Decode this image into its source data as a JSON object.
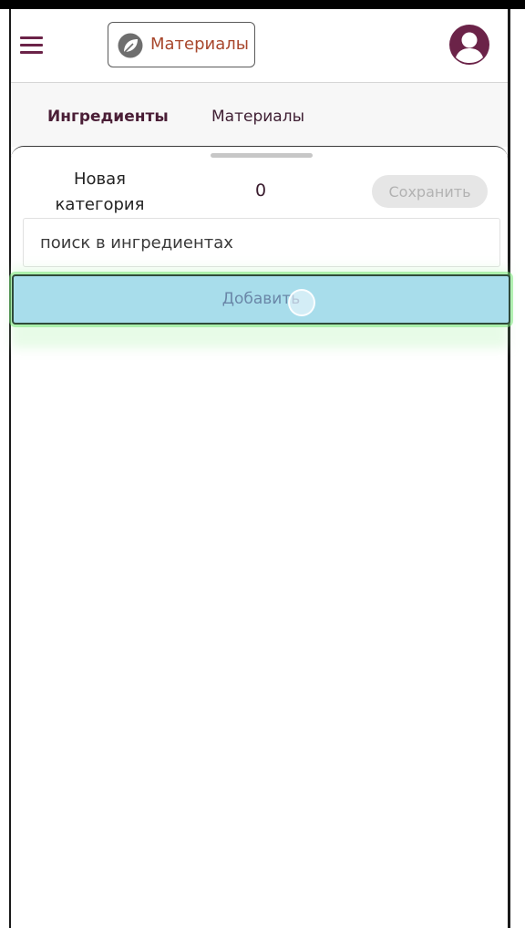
{
  "header": {
    "brand_label": "Материалы",
    "menu_icon": "hamburger-menu-icon",
    "brand_icon": "leaf-icon",
    "avatar_icon": "user-avatar-icon"
  },
  "tabs": [
    {
      "label": "Ингредиенты",
      "active": true
    },
    {
      "label": "Материалы",
      "active": false
    }
  ],
  "sheet": {
    "category_name": "Новая категория",
    "count": "0",
    "save_label": "Сохранить",
    "search_placeholder": "поиск в ингредиентах",
    "add_label": "Добавить"
  },
  "colors": {
    "brand_accent": "#6b2348",
    "brand_text": "#a8472c",
    "add_button_bg": "#a8ddeb",
    "save_button_bg": "#e6e6e6"
  }
}
